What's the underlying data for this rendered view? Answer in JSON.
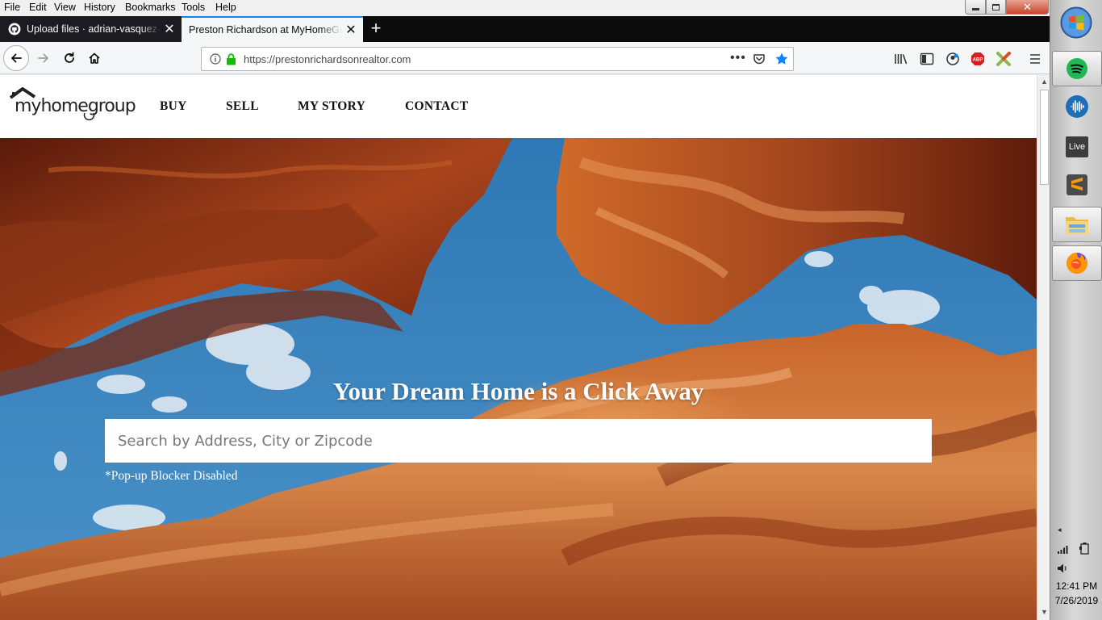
{
  "menubar": {
    "items": [
      "File",
      "Edit",
      "View",
      "History",
      "Bookmarks",
      "Tools",
      "Help"
    ]
  },
  "tabs": [
    {
      "title": "Upload files · adrian-vasquez-d",
      "active": false
    },
    {
      "title": "Preston Richardson at MyHomeGroup",
      "active": true
    }
  ],
  "urlbar": {
    "url": "https://prestonrichardsonrealtor.com"
  },
  "site": {
    "logo_text": "myhomegroup",
    "nav": [
      "BUY",
      "SELL",
      "MY STORY",
      "CONTACT"
    ],
    "hero_title": "Your Dream Home is a Click Away",
    "search_placeholder": "Search by Address, City or Zipcode",
    "popup_note": "*Pop-up Blocker Disabled"
  },
  "taskbar": {
    "apps": [
      "spotify-icon",
      "audio-app-icon",
      "live-icon",
      "sublime-text-icon",
      "file-explorer-icon",
      "firefox-icon"
    ],
    "live_label": "Live",
    "time": "12:41 PM",
    "date": "7/26/2019"
  },
  "colors": {
    "tab_accent": "#0a84ff",
    "tab_dark": "#0c0c0d",
    "lock_green": "#12bc00",
    "star_blue": "#0a84ff",
    "abp_red": "#d81e1e"
  }
}
